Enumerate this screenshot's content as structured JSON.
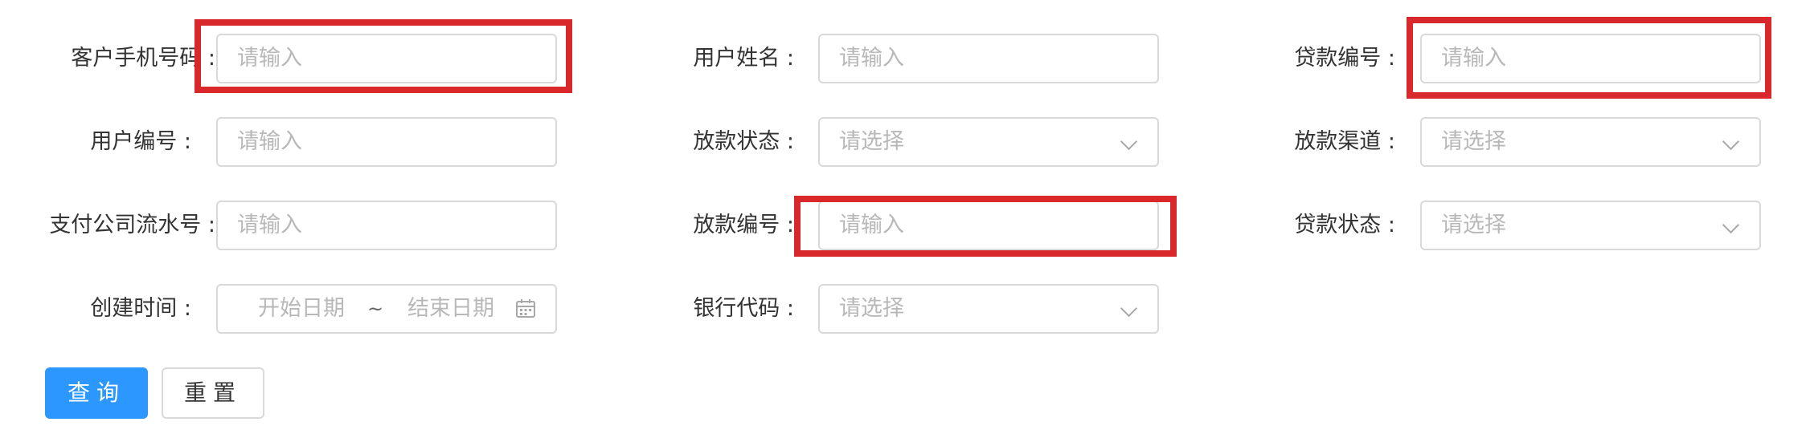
{
  "colors": {
    "primary": "#2b97ff",
    "highlight": "#d9282b",
    "border": "#d9d9d9",
    "placeholder": "#b8b8b8"
  },
  "form": {
    "customer_phone": {
      "label": "客户手机号码 :",
      "placeholder": "请输入"
    },
    "user_name": {
      "label": "用户姓名 :",
      "placeholder": "请输入"
    },
    "loan_no": {
      "label": "贷款编号 :",
      "placeholder": "请输入"
    },
    "user_no": {
      "label": "用户编号 :",
      "placeholder": "请输入"
    },
    "payout_status": {
      "label": "放款状态 :",
      "placeholder": "请选择",
      "icon": "chevron-down-icon"
    },
    "payout_channel": {
      "label": "放款渠道 :",
      "placeholder": "请选择",
      "icon": "chevron-down-icon"
    },
    "payment_serial": {
      "label": "支付公司流水号 :",
      "placeholder": "请输入"
    },
    "payout_no": {
      "label": "放款编号 :",
      "placeholder": "请输入"
    },
    "loan_status": {
      "label": "贷款状态 :",
      "placeholder": "请选择",
      "icon": "chevron-down-icon"
    },
    "created_time": {
      "label": "创建时间 :",
      "start_placeholder": "开始日期",
      "separator": "~",
      "end_placeholder": "结束日期",
      "icon": "calendar-icon"
    },
    "bank_code": {
      "label": "银行代码 :",
      "placeholder": "请选择",
      "icon": "chevron-down-icon"
    }
  },
  "buttons": {
    "query": "查询",
    "reset": "重置"
  }
}
